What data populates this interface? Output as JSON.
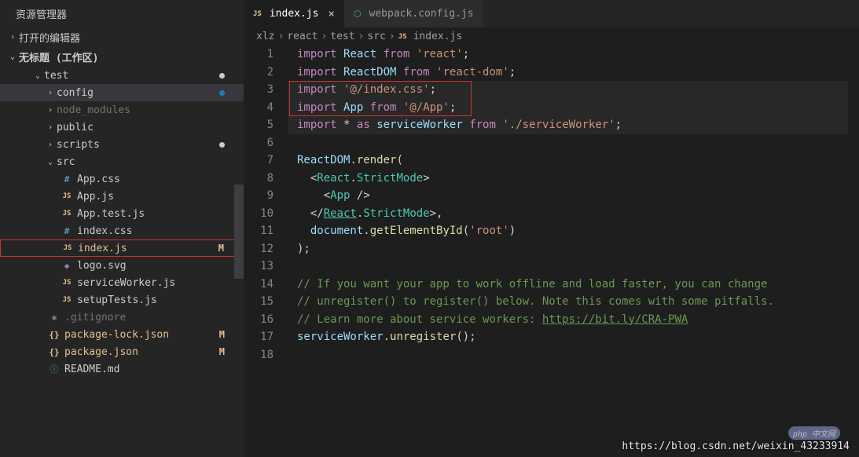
{
  "explorer": {
    "title": "资源管理器",
    "sections": {
      "open_editors": "打开的编辑器",
      "workspace": "无标题 (工作区)"
    },
    "tree": {
      "test": {
        "label": "test",
        "status": "dot"
      },
      "config": {
        "label": "config",
        "status": "dot",
        "active": true
      },
      "node_modules": {
        "label": "node_modules"
      },
      "public": {
        "label": "public"
      },
      "scripts": {
        "label": "scripts",
        "status": "dot"
      },
      "src": {
        "label": "src"
      },
      "files": {
        "app_css": "App.css",
        "app_js": "App.js",
        "app_test_js": "App.test.js",
        "index_css": "index.css",
        "index_js": "index.js",
        "logo_svg": "logo.svg",
        "service_worker": "serviceWorker.js",
        "setup_tests": "setupTests.js",
        "gitignore": ".gitignore",
        "pkg_lock": "package-lock.json",
        "pkg": "package.json",
        "readme": "README.md"
      },
      "status_m": "M"
    }
  },
  "tabs": {
    "t1": {
      "label": "index.js",
      "icon": "JS"
    },
    "t2": {
      "label": "webpack.config.js",
      "icon": "JS"
    }
  },
  "breadcrumb": {
    "parts": [
      "xlz",
      "react",
      "test",
      "src",
      "index.js"
    ],
    "sep": "›",
    "icon": "JS"
  },
  "code": {
    "lines": [
      {
        "n": 1,
        "t": "<kw>import</kw> <var>React</var> <kw>from</kw> <str>'react'</str><pn>;</pn>"
      },
      {
        "n": 2,
        "t": "<kw>import</kw> <var>ReactDOM</var> <kw>from</kw> <str>'react-dom'</str><pn>;</pn>"
      },
      {
        "n": 3,
        "t": "<kw>import</kw> <str>'@/index.css'</str><pn>;</pn>"
      },
      {
        "n": 4,
        "t": "<kw>import</kw> <var>App</var> <kw>from</kw> <str>'@/App'</str><pn>;</pn>"
      },
      {
        "n": 5,
        "t": "<kw>import</kw> <pn>*</pn> <kw>as</kw> <var>serviceWorker</var> <kw>from</kw> <str>'./serviceWorker'</str><pn>;</pn>"
      },
      {
        "n": 6,
        "t": ""
      },
      {
        "n": 7,
        "t": "<var>ReactDOM</var><pn>.</pn><fn>render</fn><pn>(</pn>"
      },
      {
        "n": 8,
        "t": "  <pn>&lt;</pn><cls>React</cls><pn>.</pn><cls>StrictMode</cls><pn>&gt;</pn>"
      },
      {
        "n": 9,
        "t": "    <pn>&lt;</pn><cls>App</cls> <pn>/&gt;</pn>"
      },
      {
        "n": 10,
        "t": "  <pn>&lt;/</pn><cls><u>React</u></cls><pn>.</pn><cls>StrictMode</cls><pn>&gt;,</pn>"
      },
      {
        "n": 11,
        "t": "  <var>document</var><pn>.</pn><fn>getElementById</fn><pn>(</pn><str>'root'</str><pn>)</pn>"
      },
      {
        "n": 12,
        "t": "<pn>);</pn>"
      },
      {
        "n": 13,
        "t": ""
      },
      {
        "n": 14,
        "t": "<cmt>// If you want your app to work offline and load faster, you can change</cmt>"
      },
      {
        "n": 15,
        "t": "<cmt>// unregister() to register() below. Note this comes with some pitfalls.</cmt>"
      },
      {
        "n": 16,
        "t": "<cmt>// Learn more about service workers: </cmt><link>https://bit.ly/CRA-PWA</link>"
      },
      {
        "n": 17,
        "t": "<var>serviceWorker</var><pn>.</pn><fn>unregister</fn><pn>();</pn>"
      },
      {
        "n": 18,
        "t": ""
      }
    ]
  },
  "watermark": "https://blog.csdn.net/weixin_43233914",
  "badge": "php 中文网"
}
